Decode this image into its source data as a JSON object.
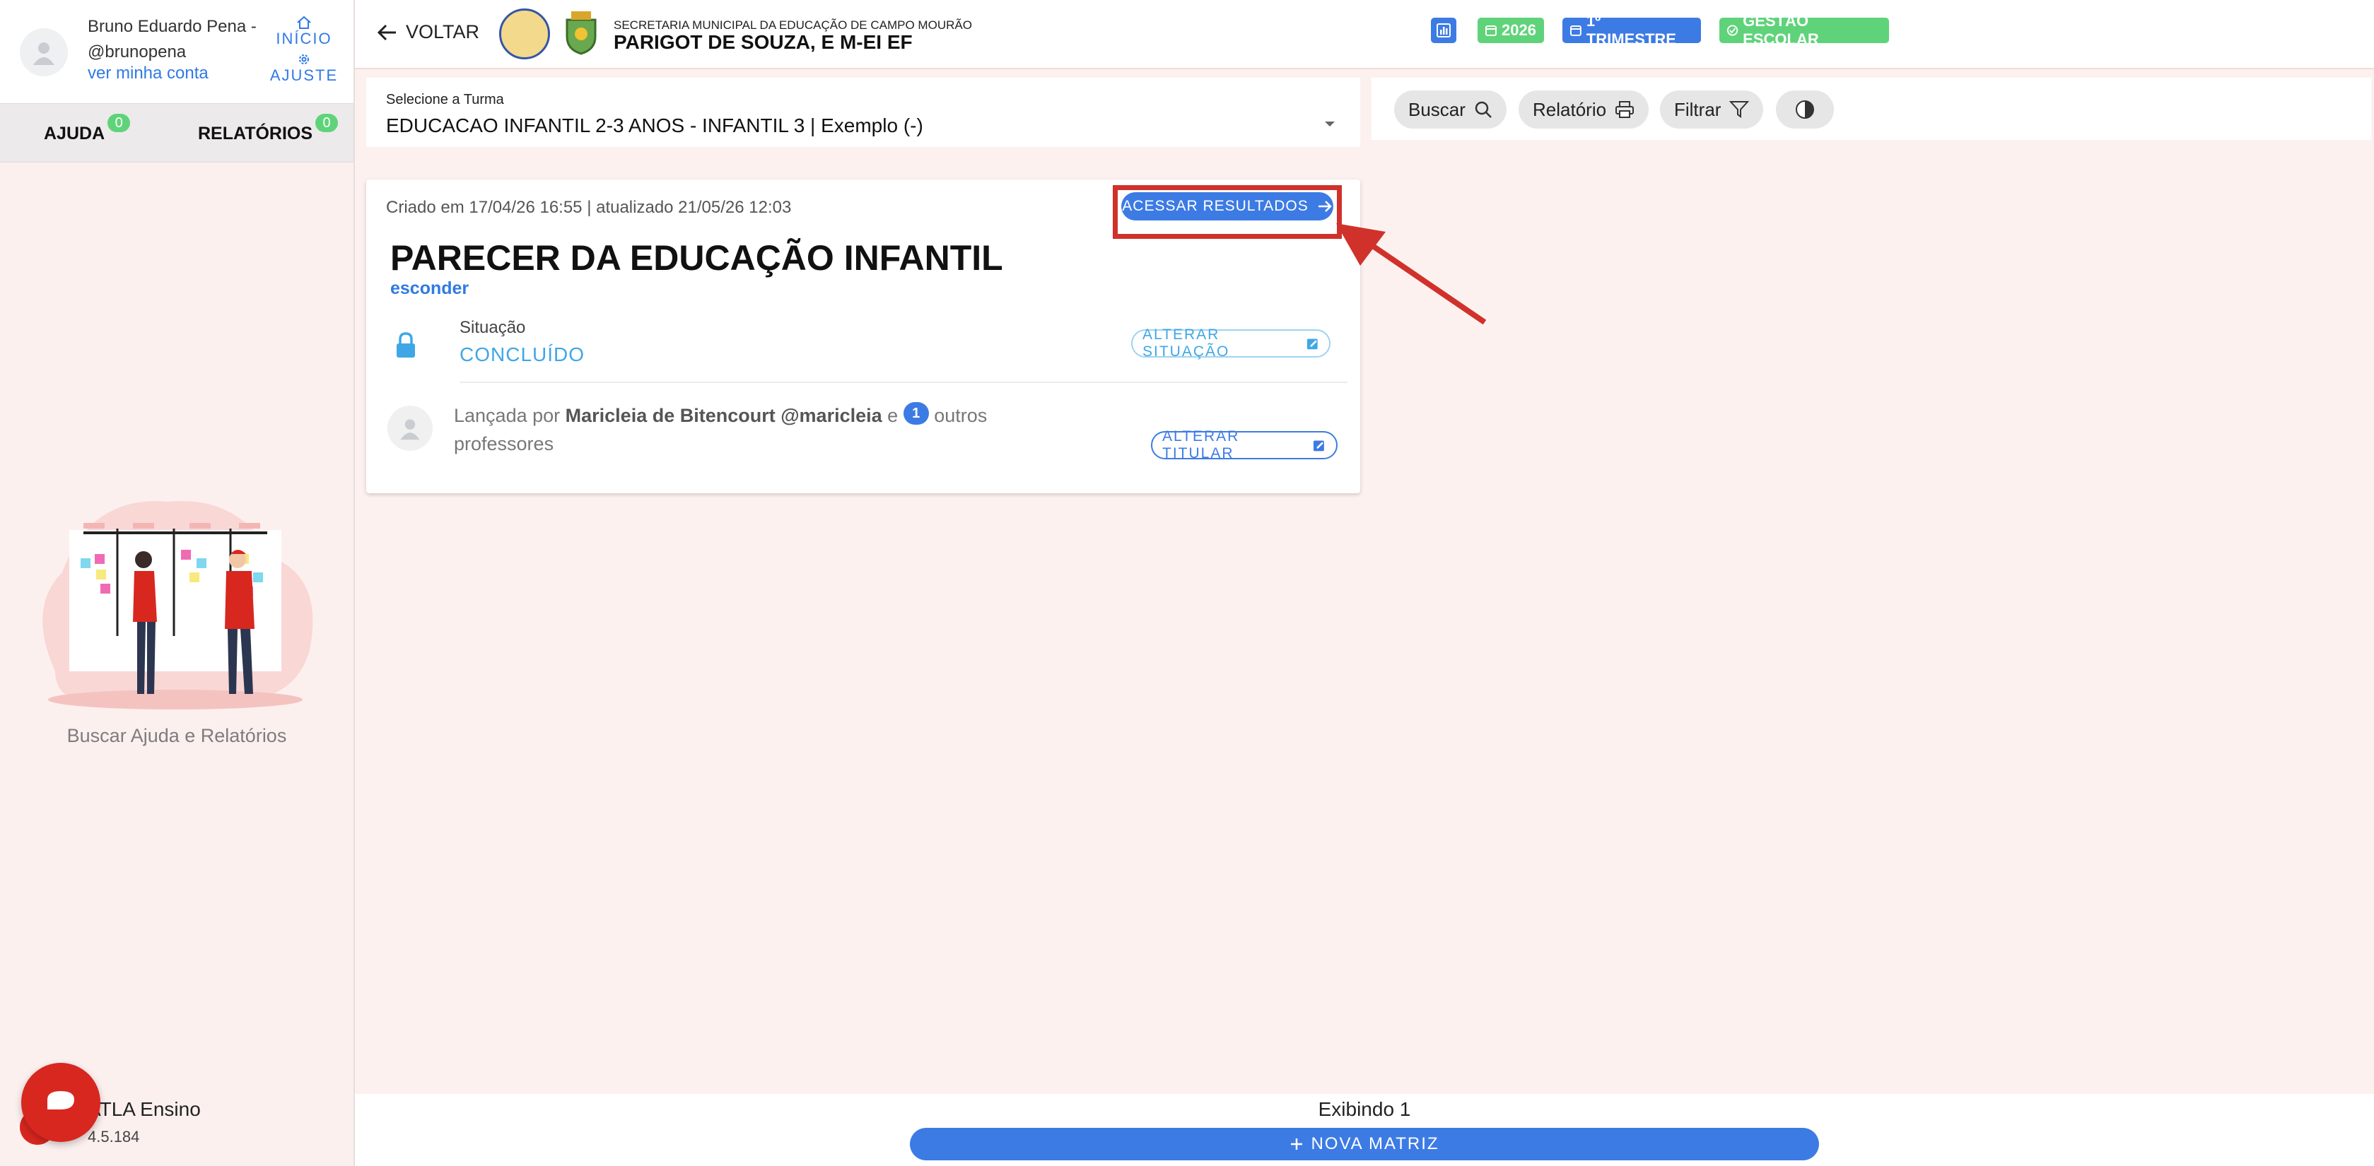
{
  "sidebar": {
    "user_name": "Bruno Eduardo Pena - @brunopena",
    "account_link": "ver minha conta",
    "nav": {
      "home": "INÍCIO",
      "settings": "AJUSTE"
    },
    "tabs": [
      {
        "label": "AJUDA",
        "count": "0"
      },
      {
        "label": "RELATÓRIOS",
        "count": "0"
      }
    ],
    "help_caption": "Buscar Ajuda e Relatórios",
    "brand": "ATLA Ensino",
    "version": "4.5.184"
  },
  "header": {
    "back_label": "VOLTAR",
    "org_line1": "SECRETARIA MUNICIPAL DA EDUCAÇÃO DE CAMPO MOURÃO",
    "org_line2": "PARIGOT DE SOUZA, E M-EI EF",
    "chips": {
      "year": "2026",
      "term": "1º TRIMESTRE",
      "mode": "GESTÃO ESCOLAR"
    },
    "colors": {
      "blue": "#3d7be4",
      "green": "#5fd37a"
    }
  },
  "class_select": {
    "label": "Selecione a Turma",
    "value": "EDUCACAO INFANTIL 2-3 ANOS - INFANTIL 3 | Exemplo (-)"
  },
  "toolbar": {
    "search": "Buscar",
    "report": "Relatório",
    "filter": "Filtrar"
  },
  "card": {
    "meta": "Criado em 17/04/26 16:55 | atualizado 21/05/26 12:03",
    "access_button": "ACESSAR RESULTADOS",
    "title": "PARECER DA EDUCAÇÃO INFANTIL",
    "hide_link": "esconder",
    "status_label": "Situação",
    "status_value": "CONCLUÍDO",
    "change_status": "ALTERAR SITUAÇÃO",
    "launched_prefix": "Lançada por",
    "launched_by": "Maricleia de Bitencourt @maricleia",
    "launched_and": "e",
    "others_count": "1",
    "launched_suffix": "outros professores",
    "change_holder": "ALTERAR TITULAR"
  },
  "footer": {
    "showing": "Exibindo 1",
    "new_button": "NOVA MATRIZ"
  }
}
